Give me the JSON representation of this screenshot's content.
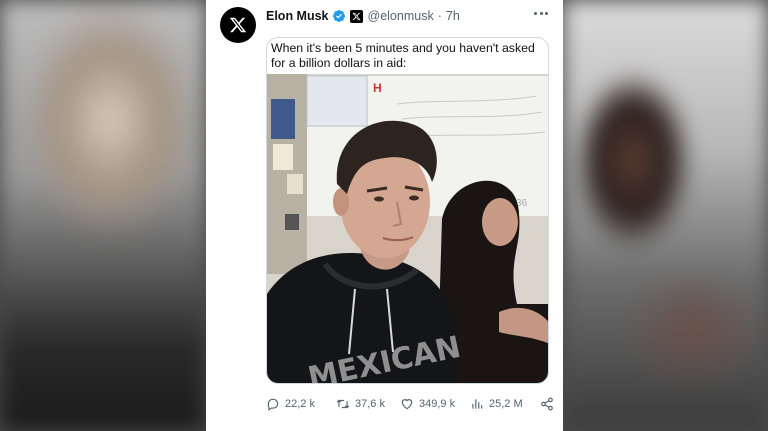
{
  "tweet": {
    "display_name": "Elon Musk",
    "handle": "@elonmusk",
    "separator": "·",
    "time": "7h",
    "caption": "When it's been 5 minutes and you haven't asked for a billion dollars in aid:",
    "photo_shirt_text": "MEXICAN",
    "stats": {
      "replies": "22,2 k",
      "retweets": "37,6 k",
      "likes": "349,9 k",
      "views": "25,2 M"
    }
  },
  "icons": {
    "avatar": "x-logo-icon",
    "verified": "verified-badge-icon",
    "affiliate": "x-affiliate-badge-icon",
    "more": "more-icon",
    "reply": "reply-icon",
    "retweet": "retweet-icon",
    "like": "heart-icon",
    "views": "views-icon",
    "share": "share-icon"
  },
  "colors": {
    "text_primary": "#0f1419",
    "text_secondary": "#536471",
    "verified_blue": "#1d9bf0",
    "card_border": "#cfd9de"
  }
}
